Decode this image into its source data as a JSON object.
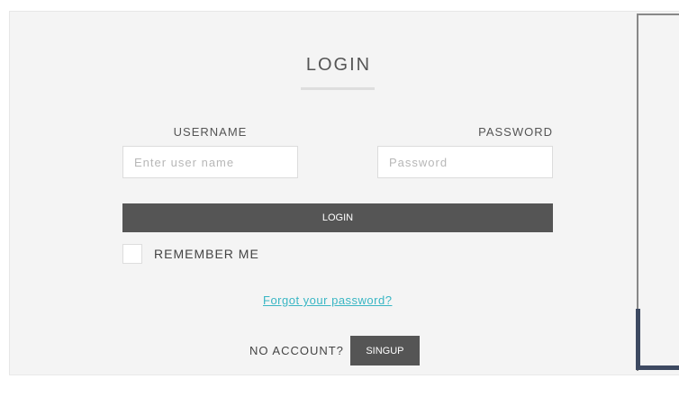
{
  "login_form": {
    "title": "LOGIN",
    "username": {
      "label": "USERNAME",
      "placeholder": "Enter user name",
      "value": ""
    },
    "password": {
      "label": "PASSWORD",
      "placeholder": "Password",
      "value": ""
    },
    "login_button_label": "LOGIN",
    "remember_me": {
      "label": "REMEMBER ME",
      "checked": false
    },
    "forgot_password_link": "Forgot your password?",
    "no_account_text": "NO ACCOUNT?",
    "signup_button_label": "SINGUP"
  },
  "colors": {
    "panel_background": "#f4f4f4",
    "button_background": "#555555",
    "link": "#39b6c4",
    "accent_frame": "#3d4961"
  }
}
